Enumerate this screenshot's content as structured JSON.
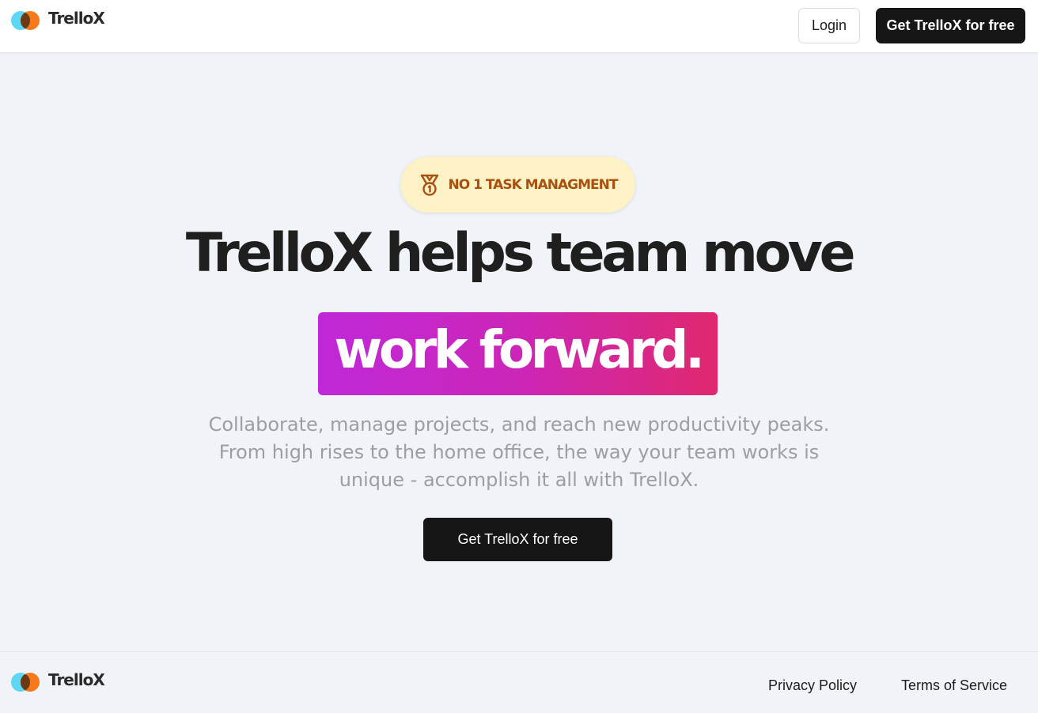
{
  "header": {
    "brand": "TrelloX",
    "login_label": "Login",
    "cta_label": "Get TrelloX for free"
  },
  "hero": {
    "badge_icon": "medal-icon",
    "badge_text": "NO 1 TASK MANAGMENT",
    "headline": "TrelloX helps team move",
    "highlight": "work forward.",
    "subtext_lines": [
      "Collaborate, manage projects, and reach new productivity peaks.",
      "From high rises to the home office, the way your team works is",
      "unique - accomplish it all with TrelloX."
    ],
    "cta_label": "Get TrelloX for free"
  },
  "footer": {
    "brand": "TrelloX",
    "privacy_label": "Privacy Policy",
    "terms_label": "Terms of Service"
  },
  "colors": {
    "logo_left": "#5ed6f6",
    "logo_right": "#f7791c",
    "logo_overlap": "#6b3a12",
    "badge_bg": "#fdf2c6",
    "badge_text": "#a8510f",
    "gradient_start": "#bf28d8",
    "gradient_end": "#e0286e",
    "cta_bg": "#161616",
    "page_bg": "#f0f3f7"
  }
}
